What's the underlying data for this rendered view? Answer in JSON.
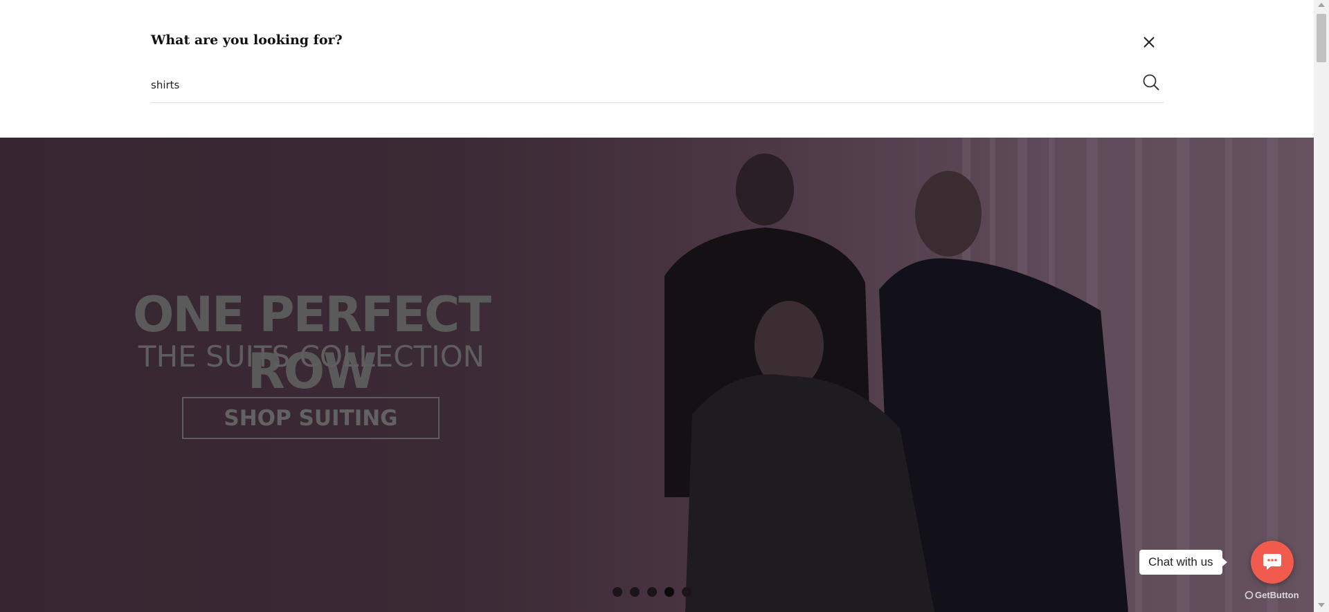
{
  "search": {
    "title": "What are you looking for?",
    "value": "shirts",
    "placeholder": "",
    "search_icon": "search-icon",
    "close_icon": "close-icon"
  },
  "hero": {
    "headline": "ONE PERFECT ROW",
    "subheadline": "THE SUITS COLLECTION",
    "cta_label": "SHOP SUITING",
    "slides_total": 5,
    "active_slide": 4
  },
  "chat": {
    "label": "Chat with us",
    "icon": "chat-icon",
    "brand": "GetButton",
    "accent": "#f05b4e"
  },
  "colors": {
    "overlay": "#3b2a35",
    "panel": "#ffffff"
  }
}
